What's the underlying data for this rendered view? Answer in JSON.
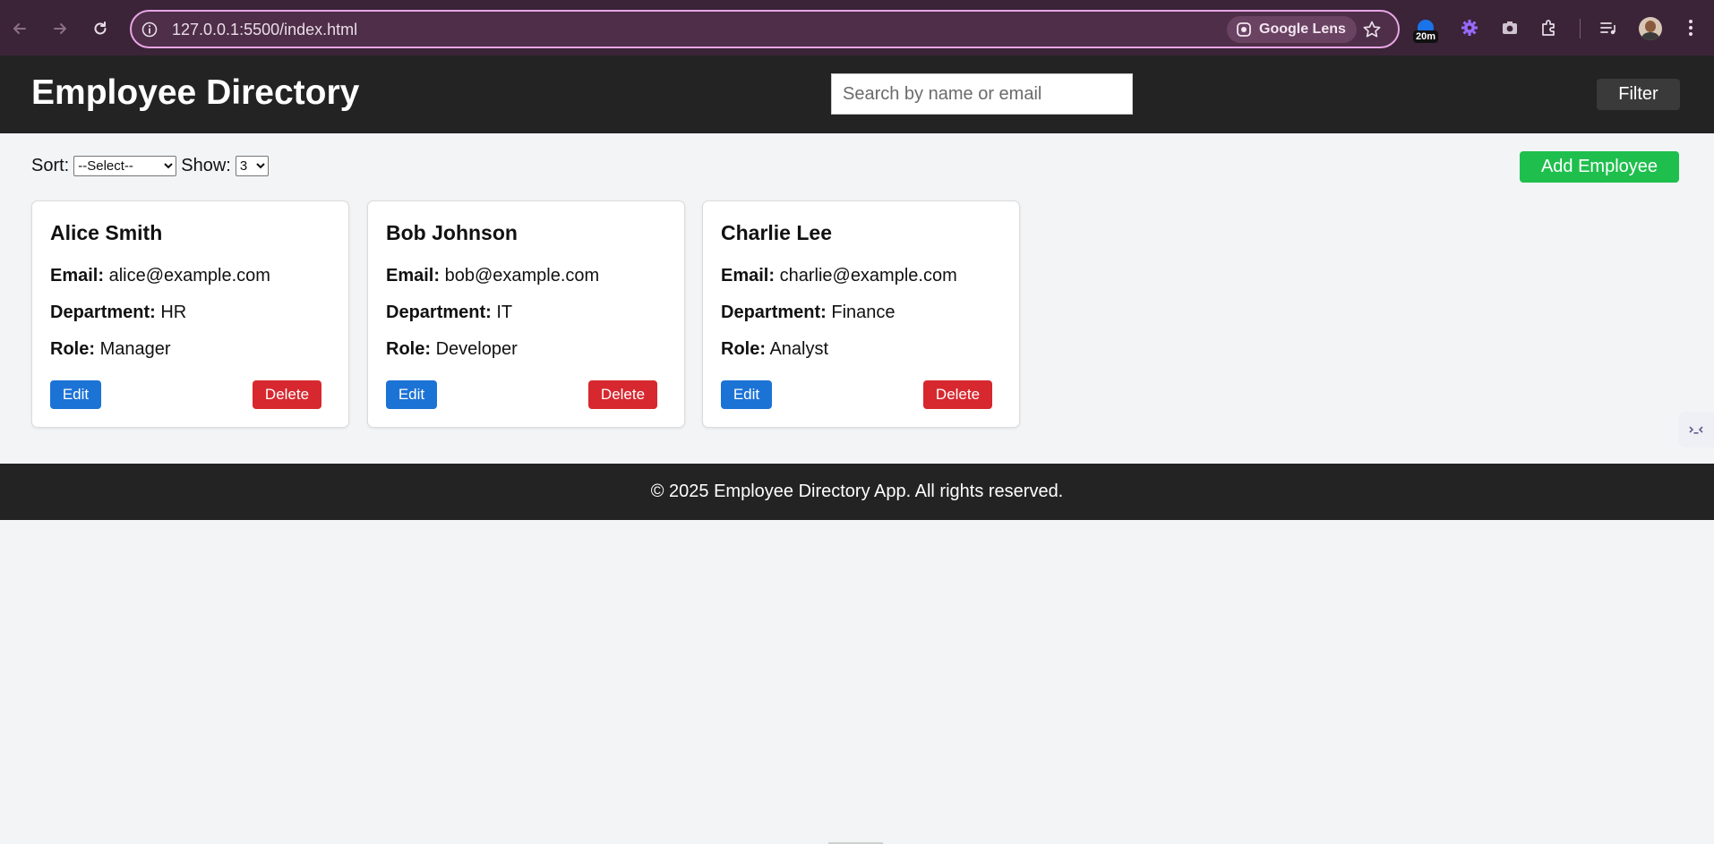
{
  "browser": {
    "url": "127.0.0.1:5500/index.html",
    "lens_label": "Google Lens",
    "timer_badge": "20m",
    "colors": {
      "frame": "#3b2438",
      "omnibox_border": "#e7a6e5"
    }
  },
  "header": {
    "title": "Employee Directory",
    "search_placeholder": "Search by name or email",
    "filter_label": "Filter"
  },
  "toolbar": {
    "sort_label": "Sort:",
    "sort_selected": "--Select--",
    "show_label": "Show:",
    "show_selected": "3",
    "add_label": "Add Employee"
  },
  "field_labels": {
    "email": "Email:",
    "department": "Department:",
    "role": "Role:"
  },
  "employees": [
    {
      "name": "Alice Smith",
      "email": "alice@example.com",
      "department": "HR",
      "role": "Manager",
      "edit": "Edit",
      "delete": "Delete"
    },
    {
      "name": "Bob Johnson",
      "email": "bob@example.com",
      "department": "IT",
      "role": "Developer",
      "edit": "Edit",
      "delete": "Delete"
    },
    {
      "name": "Charlie Lee",
      "email": "charlie@example.com",
      "department": "Finance",
      "role": "Analyst",
      "edit": "Edit",
      "delete": "Delete"
    }
  ],
  "footer": {
    "text": "© 2025 Employee Directory App. All rights reserved."
  },
  "colors": {
    "header_bg": "#232323",
    "add_button": "#1fbf4d",
    "edit_button": "#1c73d6",
    "delete_button": "#d7282f",
    "page_bg": "#f3f4f6"
  },
  "icons": [
    "back-arrow-icon",
    "forward-arrow-icon",
    "reload-icon",
    "site-info-icon",
    "google-lens-icon",
    "bookmark-star-icon",
    "gear-extension-icon",
    "camera-extension-icon",
    "puzzle-extensions-icon",
    "media-queue-icon",
    "profile-avatar",
    "more-menu-icon",
    "side-panel-icon"
  ]
}
